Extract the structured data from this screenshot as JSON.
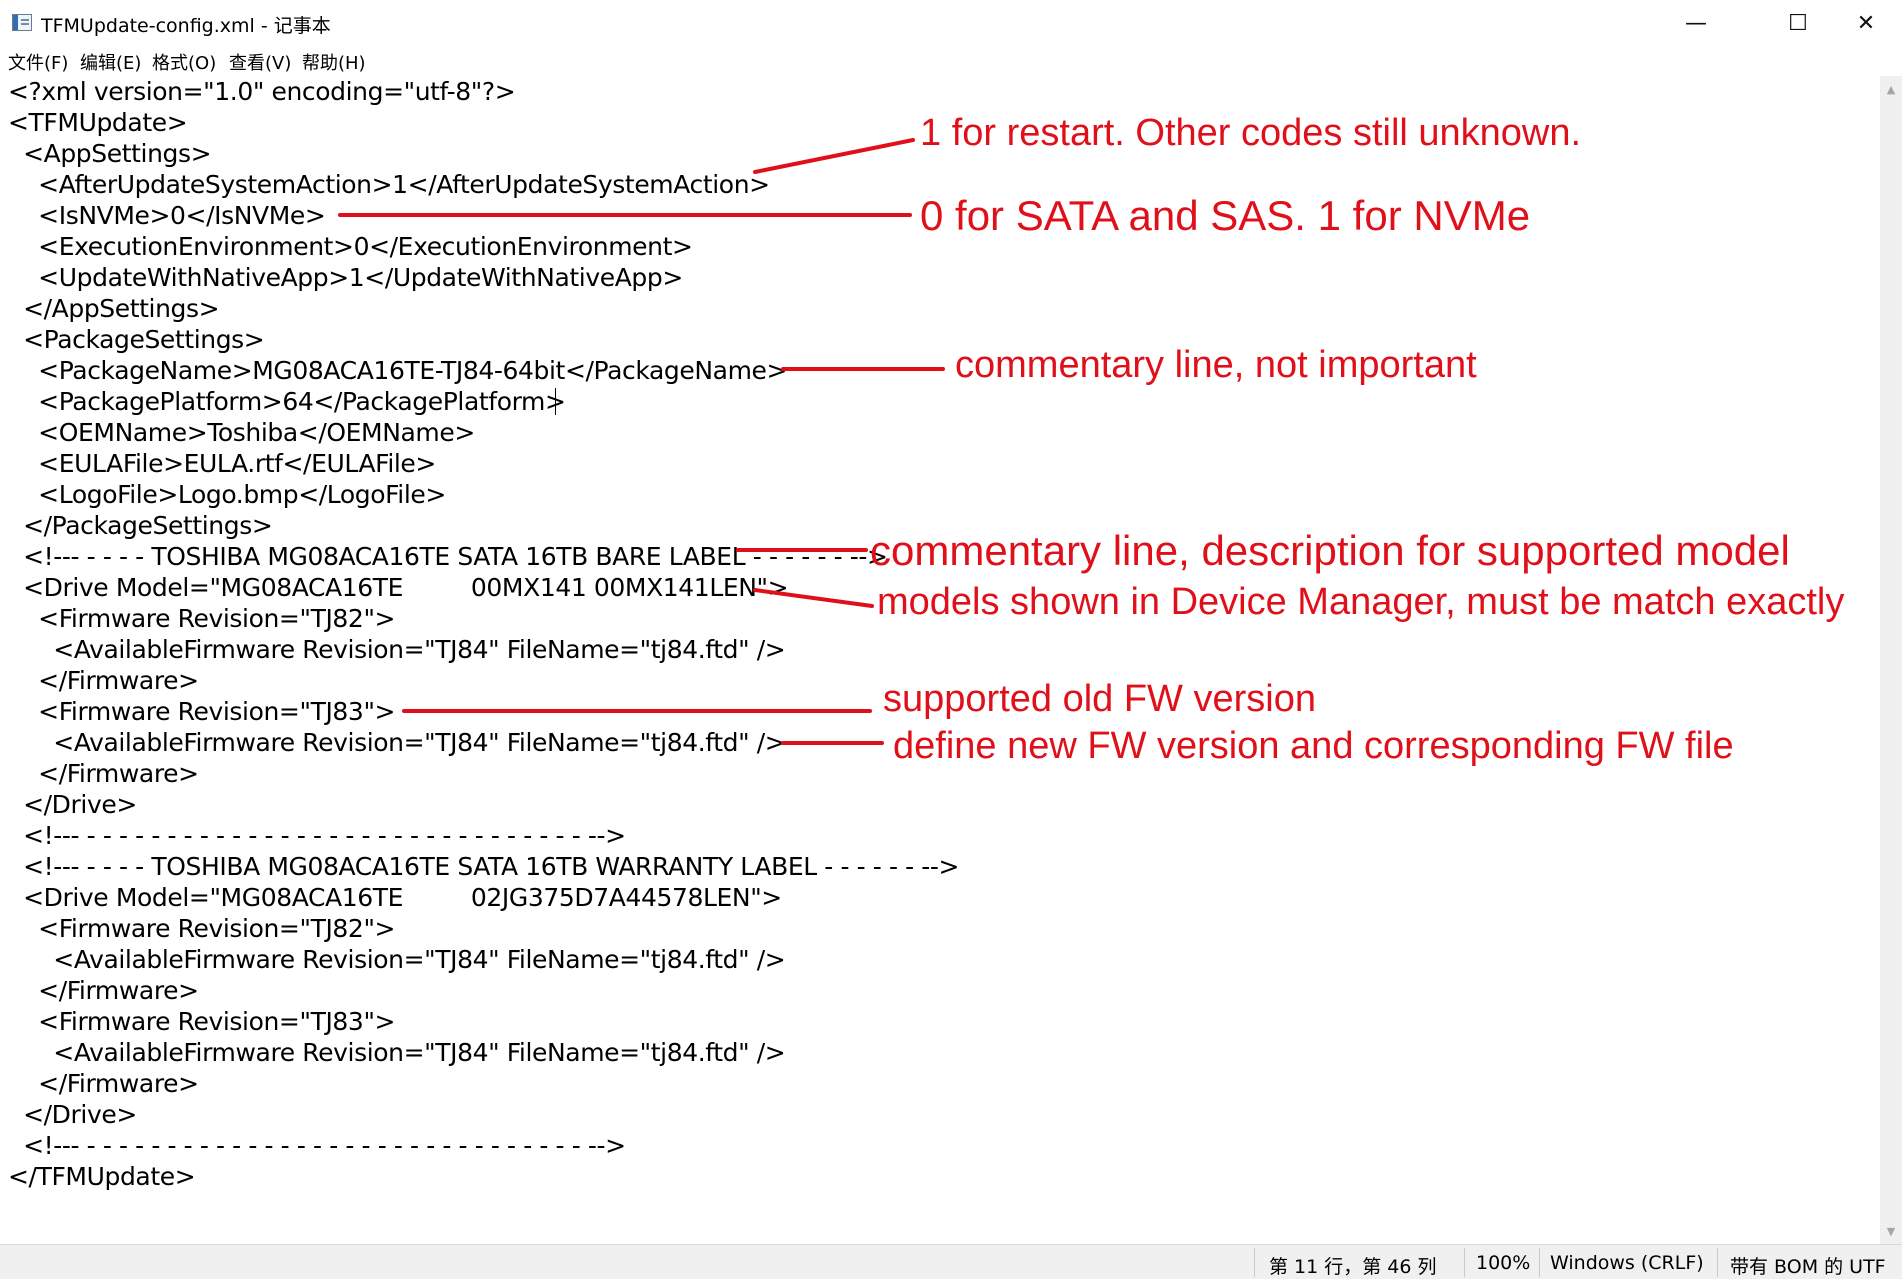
{
  "window": {
    "title": "TFMUpdate-config.xml - 记事本",
    "minimize_glyph": "—",
    "maximize_glyph": "☐",
    "close_glyph": "✕",
    "icon": "notepad-icon"
  },
  "menu": [
    {
      "label": "文件(F)"
    },
    {
      "label": "编辑(E)"
    },
    {
      "label": "格式(O)"
    },
    {
      "label": "查看(V)"
    },
    {
      "label": "帮助(H)"
    }
  ],
  "editor": {
    "lines": [
      "<?xml version=\"1.0\" encoding=\"utf-8\"?>",
      "<TFMUpdate>",
      "  <AppSettings>",
      "    <AfterUpdateSystemAction>1</AfterUpdateSystemAction>",
      "    <IsNVMe>0</IsNVMe>",
      "    <ExecutionEnvironment>0</ExecutionEnvironment>",
      "    <UpdateWithNativeApp>1</UpdateWithNativeApp>",
      "  </AppSettings>",
      "  <PackageSettings>",
      "    <PackageName>MG08ACA16TE-TJ84-64bit</PackageName>",
      "    <PackagePlatform>64</PackagePlatform>",
      "    <OEMName>Toshiba</OEMName>",
      "    <EULAFile>EULA.rtf</EULAFile>",
      "    <LogoFile>Logo.bmp</LogoFile>",
      "  </PackageSettings>",
      "  <!--- - - - - TOSHIBA MG08ACA16TE SATA 16TB BARE LABEL - - - - - - -->",
      "  <Drive Model=\"MG08ACA16TE         00MX141 00MX141LEN\">",
      "    <Firmware Revision=\"TJ82\">",
      "      <AvailableFirmware Revision=\"TJ84\" FileName=\"tj84.ftd\" />",
      "    </Firmware>",
      "    <Firmware Revision=\"TJ83\">",
      "      <AvailableFirmware Revision=\"TJ84\" FileName=\"tj84.ftd\" />",
      "    </Firmware>",
      "  </Drive>",
      "  <!--- - - - - - - - - - - - - - - - - - - - - - - - - - - - - - - - -->",
      "  <!--- - - - - TOSHIBA MG08ACA16TE SATA 16TB WARRANTY LABEL - - - - - - -->",
      "  <Drive Model=\"MG08ACA16TE         02JG375D7A44578LEN\">",
      "    <Firmware Revision=\"TJ82\">",
      "      <AvailableFirmware Revision=\"TJ84\" FileName=\"tj84.ftd\" />",
      "    </Firmware>",
      "    <Firmware Revision=\"TJ83\">",
      "      <AvailableFirmware Revision=\"TJ84\" FileName=\"tj84.ftd\" />",
      "    </Firmware>",
      "  </Drive>",
      "  <!--- - - - - - - - - - - - - - - - - - - - - - - - - - - - - - - - -->",
      "</TFMUpdate>"
    ]
  },
  "annotations": [
    {
      "text": "1 for restart. Other codes still unknown."
    },
    {
      "text": "0 for SATA and SAS. 1 for NVMe"
    },
    {
      "text": "commentary line, not important"
    },
    {
      "text": "commentary line, description for supported model"
    },
    {
      "text": "models shown in Device Manager, must be match exactly"
    },
    {
      "text": "supported old FW version"
    },
    {
      "text": "define new FW version and corresponding FW file"
    }
  ],
  "status": {
    "position": "第 11 行，第 46 列",
    "zoom": "100%",
    "line_ending": "Windows (CRLF)",
    "encoding": "带有 BOM 的 UTF"
  },
  "colors": {
    "annotation": "#e0101a",
    "statusbar": "#f0f0f0"
  }
}
